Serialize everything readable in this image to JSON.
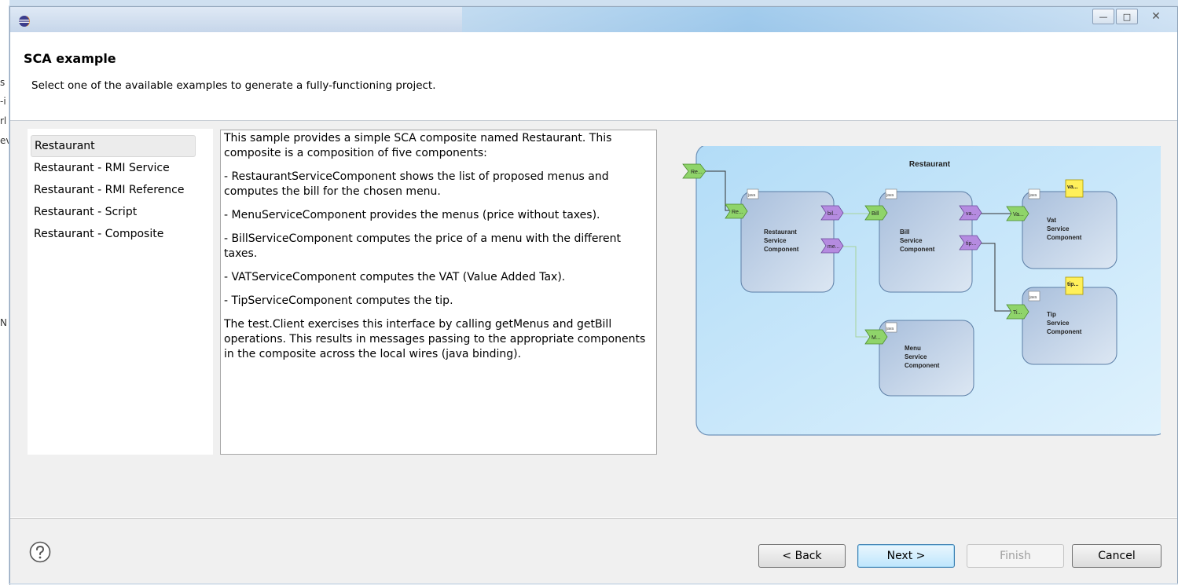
{
  "background": {
    "left_fragments": [
      "s",
      "-i",
      "rl",
      "ev",
      "N"
    ]
  },
  "window": {
    "controls": {
      "minimize": "—",
      "maximize": "□",
      "close": "✕"
    }
  },
  "header": {
    "title": "SCA example",
    "subtitle": "Select one of the available examples to generate a fully-functioning project."
  },
  "examples": {
    "selected_index": 0,
    "items": [
      {
        "label": "Restaurant"
      },
      {
        "label": "Restaurant - RMI Service"
      },
      {
        "label": "Restaurant - RMI Reference"
      },
      {
        "label": "Restaurant - Script"
      },
      {
        "label": "Restaurant - Composite"
      }
    ]
  },
  "description": {
    "paragraphs": [
      "This sample provides a simple SCA composite named Restaurant. This composite is a composition of five components:",
      "- RestaurantServiceComponent shows the list of proposed menus and computes the bill for the chosen menu.",
      "- MenuServiceComponent provides the menus (price without taxes).",
      "- BillServiceComponent computes the price of a menu with the different taxes.",
      "- VATServiceComponent computes the VAT (Value Added Tax).",
      "- TipServiceComponent computes the tip.",
      "The test.Client exercises this interface by calling getMenus and getBill operations. This results in messages passing to the appropriate components in the composite across the local wires (java binding)."
    ]
  },
  "diagram": {
    "composite_label": "Restaurant",
    "promoted_service": "Re...",
    "components": {
      "restaurant": {
        "line1": "Restaurant",
        "line2": "Service",
        "line3": "Component",
        "service": "Re...",
        "ref1": "bil...",
        "ref2": "me..."
      },
      "bill": {
        "line1": "Bill",
        "line2": "Service",
        "line3": "Component",
        "service": "Bill",
        "ref1": "va...",
        "ref2": "tip..."
      },
      "vat": {
        "line1": "Vat",
        "line2": "Service",
        "line3": "Component",
        "service": "Va...",
        "property": "va..."
      },
      "tip": {
        "line1": "Tip",
        "line2": "Service",
        "line3": "Component",
        "service": "Ti...",
        "property": "tip..."
      },
      "menu": {
        "line1": "Menu",
        "line2": "Service",
        "line3": "Component",
        "service": "M..."
      }
    },
    "impl_tag": "java",
    "colors": {
      "panel": "#c4e6fa",
      "component": "#c3d4e8",
      "service": "#8fd46a",
      "reference": "#b58be0",
      "property": "#fff05a",
      "wire": "#333333"
    }
  },
  "footer": {
    "back_label": "< Back",
    "next_label": "Next >",
    "finish_label": "Finish",
    "cancel_label": "Cancel"
  }
}
